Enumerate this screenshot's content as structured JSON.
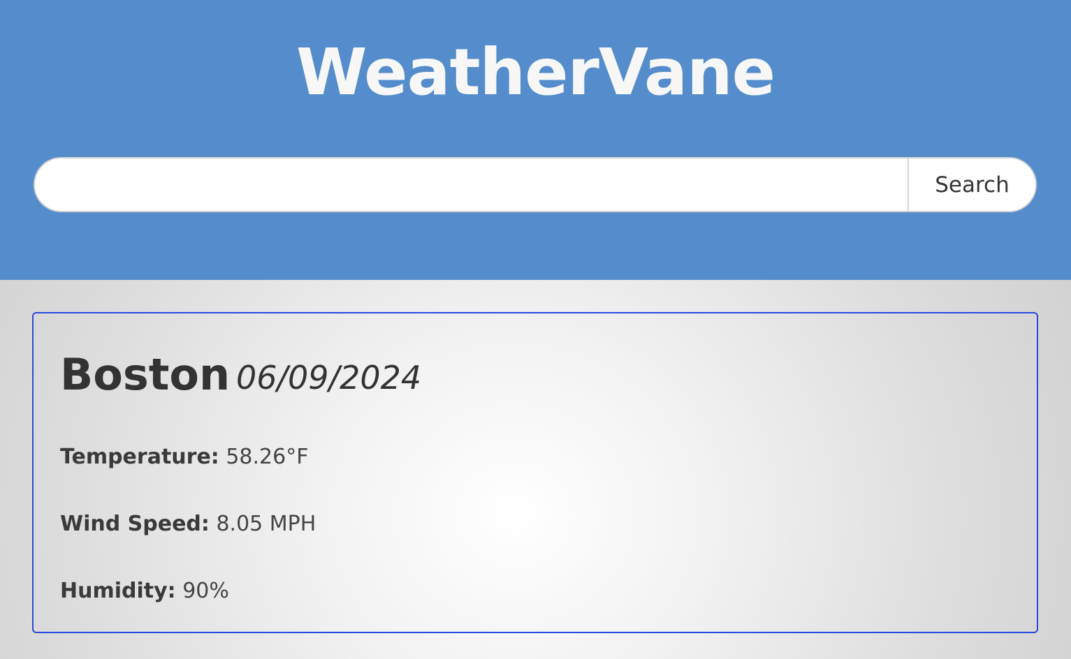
{
  "header": {
    "title": "WeatherVane",
    "bg_color": "#558dcc"
  },
  "search": {
    "value": "",
    "placeholder": "",
    "button_label": "Search"
  },
  "current": {
    "city": "Boston",
    "date": "06/09/2024",
    "border_color": "#2a49e0",
    "stats": {
      "temperature": {
        "label": "Temperature:",
        "value": "58.26°F"
      },
      "wind_speed": {
        "label": "Wind Speed:",
        "value": "8.05 MPH"
      },
      "humidity": {
        "label": "Humidity:",
        "value": "90%"
      }
    }
  }
}
